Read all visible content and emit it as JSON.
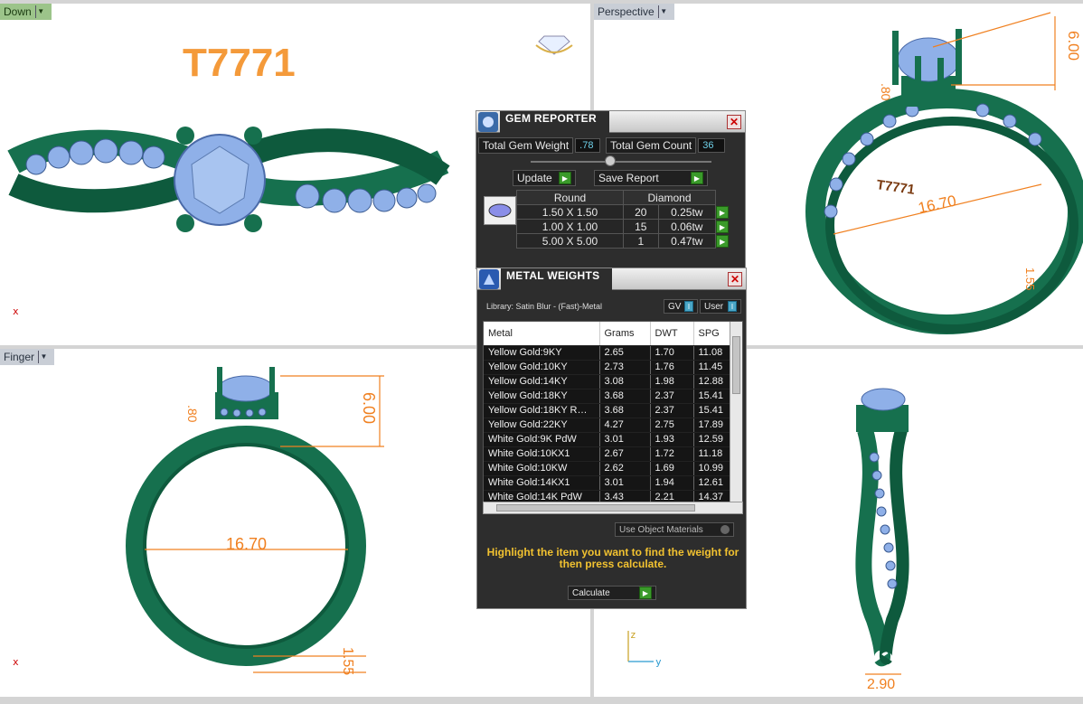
{
  "viewports": {
    "top_left": {
      "tab": "Down",
      "label": "T7771"
    },
    "top_right": {
      "tab": "Perspective",
      "dims": {
        "a": "6.00",
        "b": ".80",
        "c": "16.70",
        "d": "1.55",
        "e": "T7771"
      }
    },
    "bottom_left": {
      "tab": "Finger",
      "dims": {
        "a": ".80",
        "b": "6.00",
        "c": "16.70",
        "d": "1.55"
      }
    },
    "bottom_right": {
      "dims": {
        "a": "2.90"
      },
      "axis_z": "z",
      "axis_y": "y"
    },
    "axis_x": "x"
  },
  "gem_reporter": {
    "title": "GEM REPORTER",
    "total_weight_label": "Total Gem Weight",
    "total_weight_value": ".78",
    "total_count_label": "Total Gem Count",
    "total_count_value": "36",
    "update_label": "Update",
    "save_report_label": "Save Report",
    "col_shape": "Round",
    "col_type": "Diamond",
    "rows": [
      {
        "size": "1.50 X 1.50",
        "count": "20",
        "tw": "0.25tw"
      },
      {
        "size": "1.00 X 1.00",
        "count": "15",
        "tw": "0.06tw"
      },
      {
        "size": "5.00 X 5.00",
        "count": "1",
        "tw": "0.47tw"
      }
    ]
  },
  "metal_weights": {
    "title": "METAL WEIGHTS",
    "library": "Library: Satin Blur - (Fast)-Metal",
    "gv_label": "GV",
    "user_label": "User",
    "headers": {
      "metal": "Metal",
      "grams": "Grams",
      "dwt": "DWT",
      "spg": "SPG"
    },
    "rows": [
      {
        "metal": "Yellow Gold:9KY",
        "grams": "2.65",
        "dwt": "1.70",
        "spg": "11.08"
      },
      {
        "metal": "Yellow Gold:10KY",
        "grams": "2.73",
        "dwt": "1.76",
        "spg": "11.45"
      },
      {
        "metal": "Yellow Gold:14KY",
        "grams": "3.08",
        "dwt": "1.98",
        "spg": "12.88"
      },
      {
        "metal": "Yellow Gold:18KY",
        "grams": "3.68",
        "dwt": "2.37",
        "spg": "15.41"
      },
      {
        "metal": "Yellow Gold:18KY R…",
        "grams": "3.68",
        "dwt": "2.37",
        "spg": "15.41"
      },
      {
        "metal": "Yellow Gold:22KY",
        "grams": "4.27",
        "dwt": "2.75",
        "spg": "17.89"
      },
      {
        "metal": "White Gold:9K PdW",
        "grams": "3.01",
        "dwt": "1.93",
        "spg": "12.59"
      },
      {
        "metal": "White Gold:10KX1",
        "grams": "2.67",
        "dwt": "1.72",
        "spg": "11.18"
      },
      {
        "metal": "White Gold:10KW",
        "grams": "2.62",
        "dwt": "1.69",
        "spg": "10.99"
      },
      {
        "metal": "White Gold:14KX1",
        "grams": "3.01",
        "dwt": "1.94",
        "spg": "12.61"
      },
      {
        "metal": "White Gold:14K PdW",
        "grams": "3.43",
        "dwt": "2.21",
        "spg": "14.37"
      }
    ],
    "use_object_materials": "Use Object Materials",
    "hint": "Highlight the item you want to find the weight for then press calculate.",
    "calculate_label": "Calculate"
  },
  "colors": {
    "ring_green": "#16704e",
    "gem_blue": "#8fb0e8",
    "dimension_orange": "#f08020",
    "title_orange": "#f49a3a"
  }
}
